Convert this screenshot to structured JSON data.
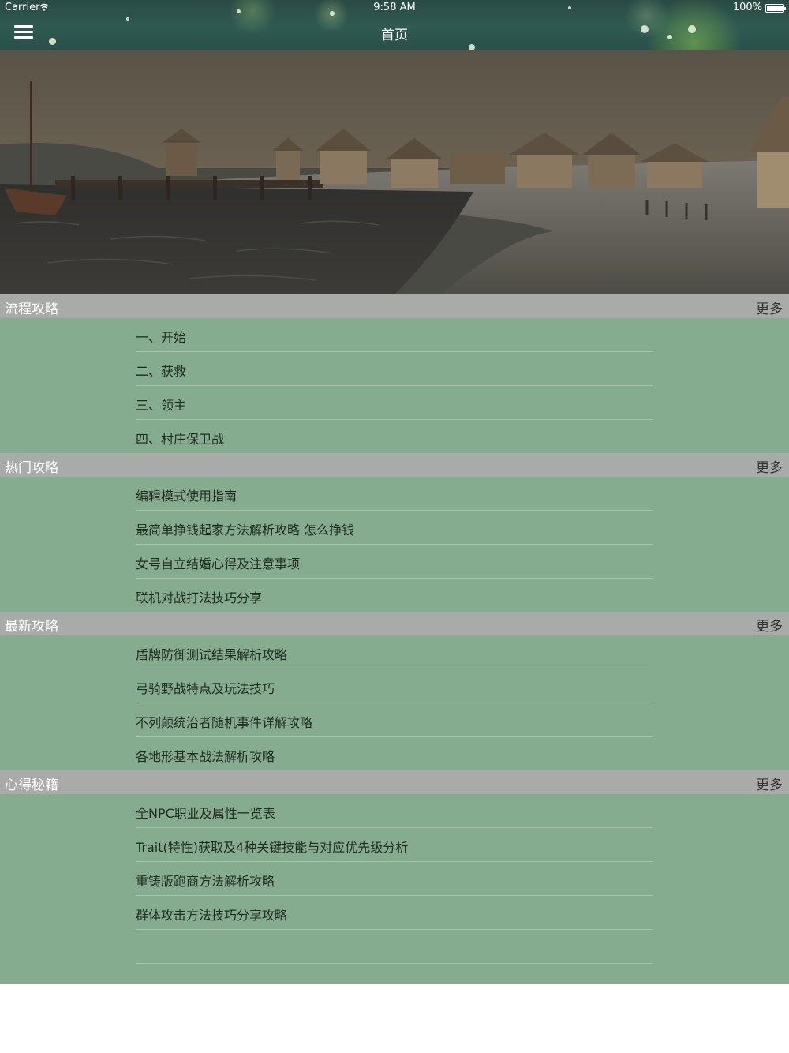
{
  "status_bar": {
    "carrier": "Carrier",
    "time": "9:58 AM",
    "battery": "100%"
  },
  "nav": {
    "title": "首页",
    "menu_icon": "hamburger-menu-icon"
  },
  "banner": {
    "page_count": 3,
    "active_page": 2
  },
  "sections": [
    {
      "title": "流程攻略",
      "more": "更多",
      "items": [
        "一、开始",
        "二、获救",
        "三、领主",
        "四、村庄保卫战"
      ]
    },
    {
      "title": "热门攻略",
      "more": "更多",
      "items": [
        "编辑模式使用指南",
        "最简单挣钱起家方法解析攻略 怎么挣钱",
        "女号自立结婚心得及注意事项",
        "联机对战打法技巧分享"
      ]
    },
    {
      "title": "最新攻略",
      "more": "更多",
      "items": [
        "盾牌防御测试结果解析攻略",
        "弓骑野战特点及玩法技巧",
        "不列颠统治者随机事件详解攻略",
        "各地形基本战法解析攻略"
      ]
    },
    {
      "title": "心得秘籍",
      "more": "更多",
      "items": [
        "全NPC职业及属性一览表",
        "Trait(特性)获取及4种关键技能与对应优先级分析",
        "重铸版跑商方法解析攻略",
        "群体攻击方法技巧分享攻略",
        ""
      ]
    }
  ],
  "colors": {
    "header_bg": "#a9aba9",
    "body_bg": "#86ac8f",
    "nav_bg": "#2f5a52"
  }
}
